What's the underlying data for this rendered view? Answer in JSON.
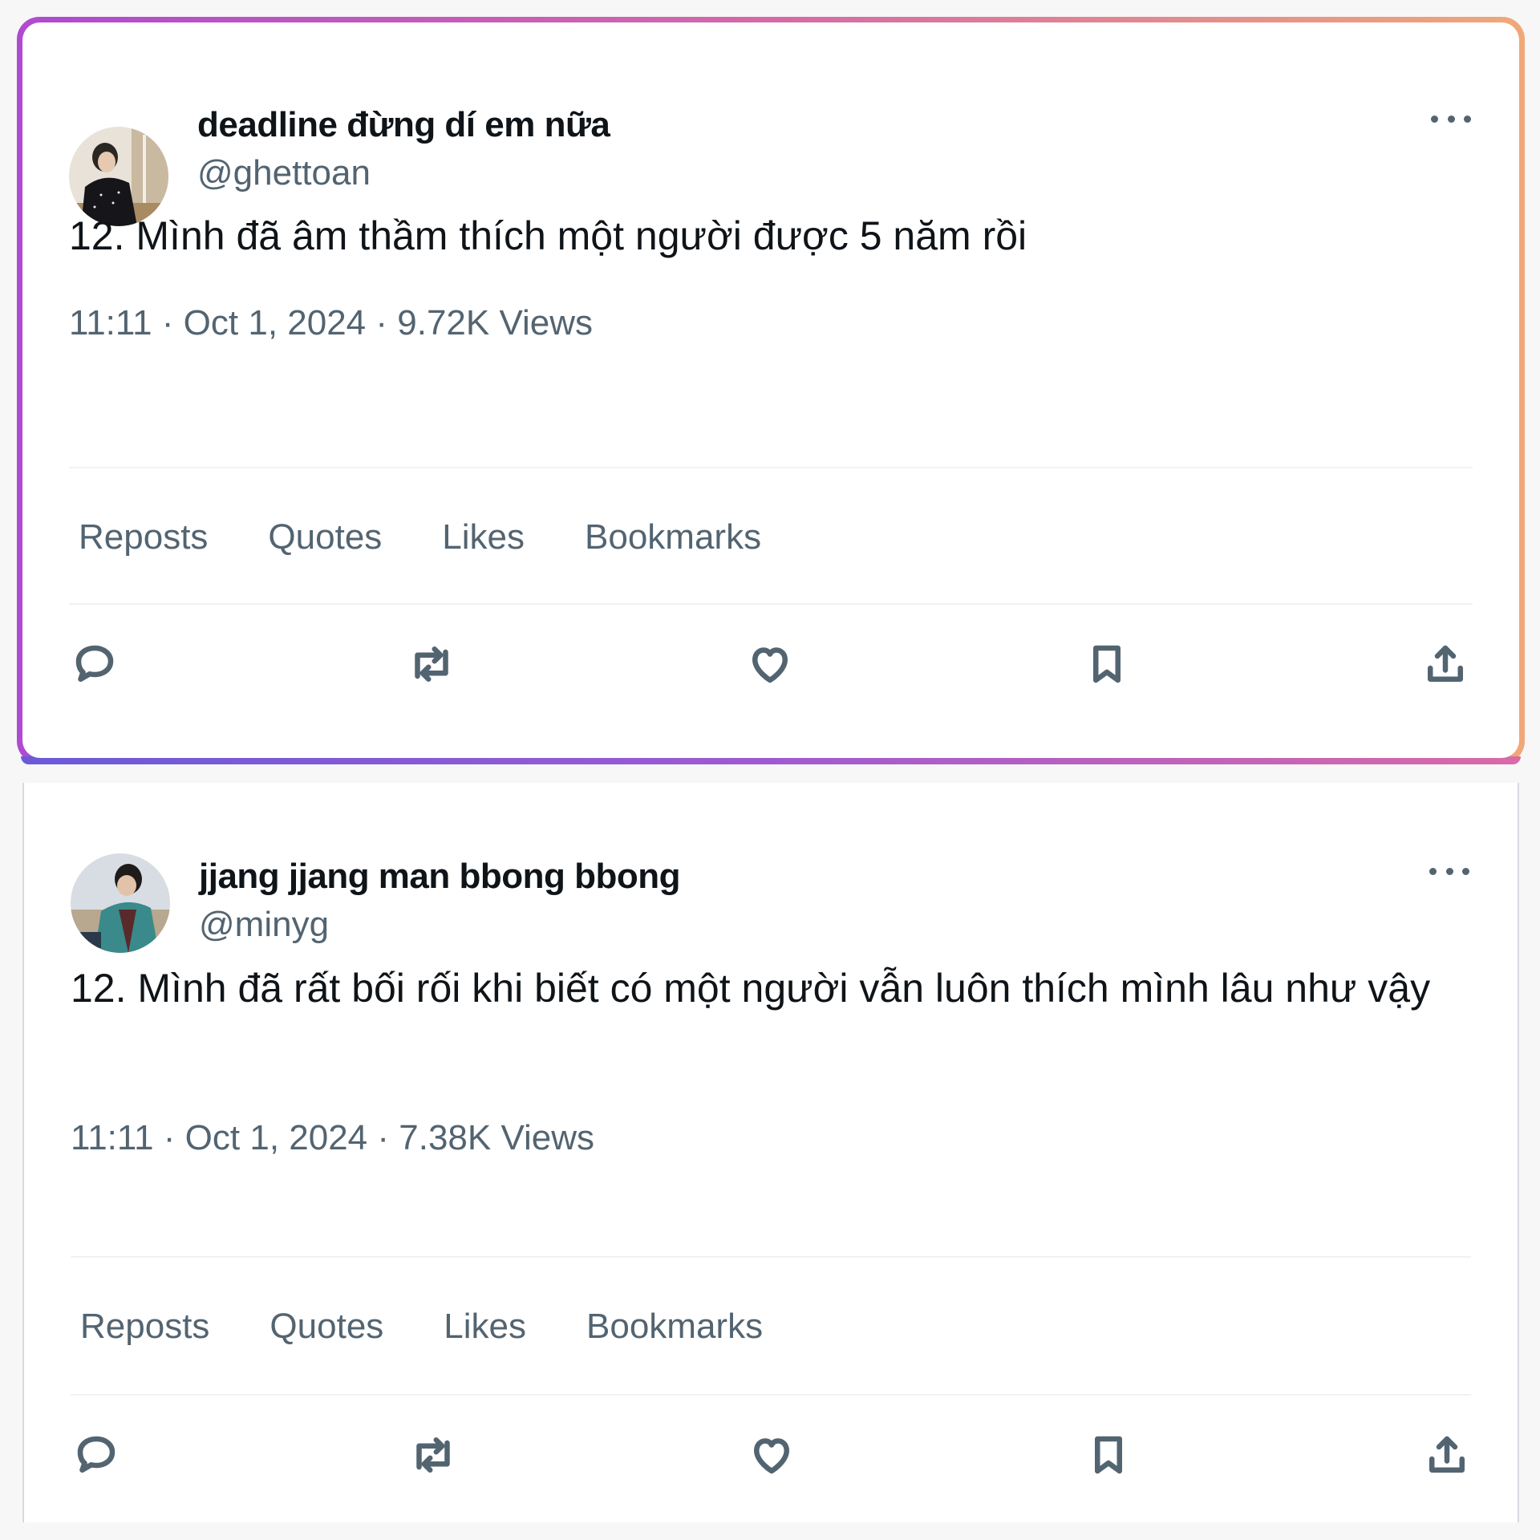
{
  "tweets": [
    {
      "display_name": "deadline đừng dí em nữa",
      "handle": "@ghettoan",
      "text": "12. Mình đã âm thầm thích một người được 5 năm rồi",
      "meta": "11:11 · Oct 1, 2024 · 9.72K Views",
      "stats": [
        "Reposts",
        "Quotes",
        "Likes",
        "Bookmarks"
      ]
    },
    {
      "display_name": "jjang jjang man bbong bbong",
      "handle": "@minyg",
      "text": "12. Mình đã rất bối rối khi biết có một người vẫn luôn thích mình lâu như vậy",
      "meta": "11:11 · Oct 1, 2024 · 7.38K Views",
      "stats": [
        "Reposts",
        "Quotes",
        "Likes",
        "Bookmarks"
      ]
    }
  ],
  "icons": [
    "reply-icon",
    "repost-icon",
    "like-icon",
    "bookmark-icon",
    "share-icon",
    "more-icon"
  ],
  "colors": {
    "text_primary": "#0f1419",
    "text_secondary": "#536471",
    "divider": "#eff3f4"
  }
}
